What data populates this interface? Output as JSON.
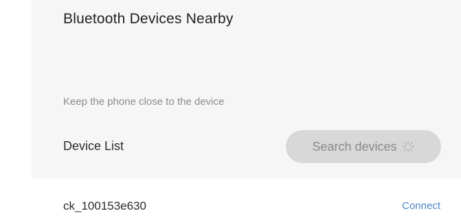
{
  "header": {
    "title": "Bluetooth Devices Nearby",
    "hint": "Keep the phone close to the device"
  },
  "device_list": {
    "label": "Device List",
    "search_button_label": "Search devices",
    "search_icon": "loading-spinner-icon",
    "devices": [
      {
        "name": "ck_100153e630",
        "action_label": "Connect"
      }
    ]
  },
  "colors": {
    "panel_background": "#f6f6f6",
    "search_button_background": "#d8d8d8",
    "connect_link": "#4a84c4"
  }
}
